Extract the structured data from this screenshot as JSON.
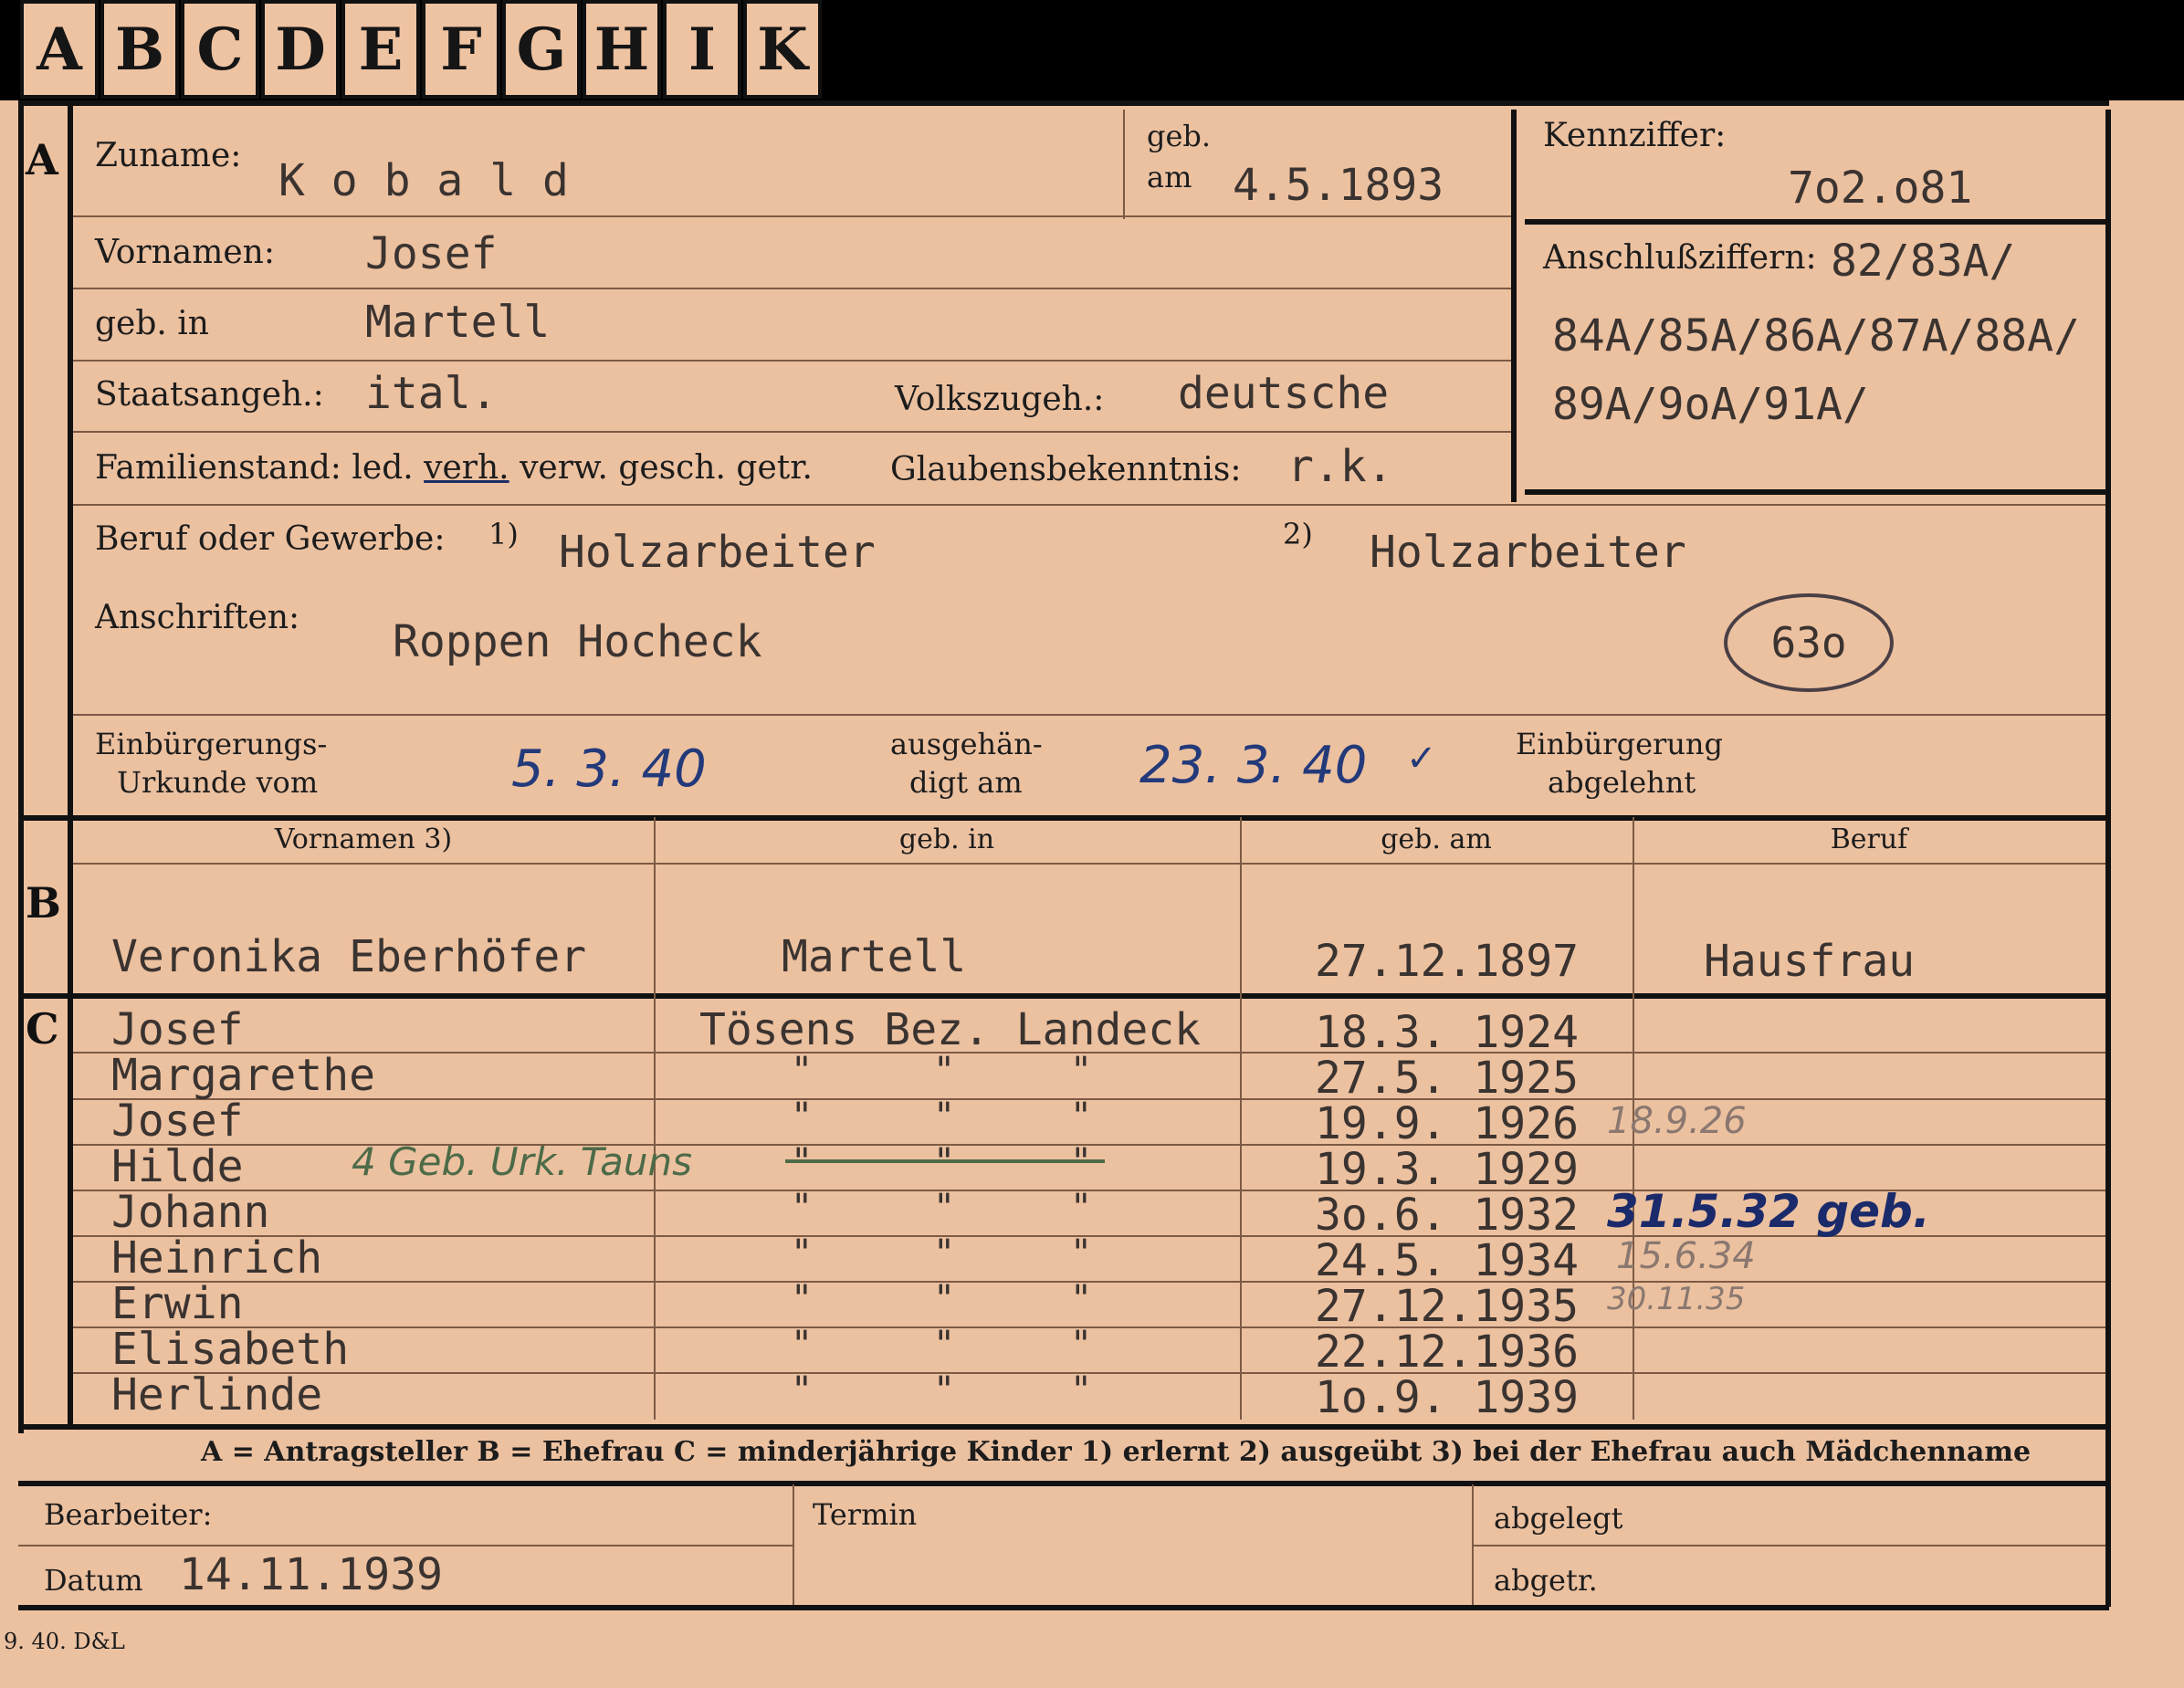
{
  "tabs": [
    "A",
    "B",
    "C",
    "D",
    "E",
    "F",
    "G",
    "H",
    "I",
    "K"
  ],
  "section_letters": {
    "a": "A",
    "b": "B",
    "c": "C"
  },
  "labels": {
    "zuname": "Zuname:",
    "geb": "geb.",
    "am": "am",
    "kennziffer": "Kennziffer:",
    "vornamen": "Vornamen:",
    "anschlussziffern": "Anschlußziffern:",
    "geb_in": "geb. in",
    "staatsangeh": "Staatsangeh.:",
    "volkszugeh": "Volkszugeh.:",
    "familienstand_prefix": "Familienstand: led.",
    "familienstand_verh": "verh.",
    "familienstand_suffix": "verw. gesch. getr.",
    "glaubensbekenntnis": "Glaubensbekenntnis:",
    "beruf": "Beruf oder Gewerbe:",
    "fn1": "1)",
    "fn2": "2)",
    "anschriften": "Anschriften:",
    "einb_urkunde_1": "Einbürgerungs-",
    "einb_urkunde_2": "Urkunde vom",
    "ausgehaendigt_1": "ausgehän-",
    "ausgehaendigt_2": "digt am",
    "einb_abgelehnt_1": "Einbürgerung",
    "einb_abgelehnt_2": "abgelehnt"
  },
  "applicant": {
    "zuname": "K o b a l d",
    "geb_am": "4.5.1893",
    "kennziffer": "7o2.o81",
    "anschluss_lines": [
      "82/83A/",
      "84A/85A/86A/87A/88A/",
      "89A/9oA/91A/"
    ],
    "vornamen": "Josef",
    "geb_in": "Martell",
    "staatsangeh": "ital.",
    "volkszugeh": "deutsche",
    "glaubensbekenntnis": "r.k.",
    "beruf_erlernt": "Holzarbeiter",
    "beruf_ausgeuebt": "Holzarbeiter",
    "anschrift": "Roppen Hocheck",
    "circled_number": "63o",
    "urkunde_vom": "5. 3. 40",
    "ausgehaendigt_am": "23. 3. 40"
  },
  "wife_headers": {
    "vornamen": "Vornamen 3)",
    "geb_in": "geb. in",
    "geb_am": "geb. am",
    "beruf": "Beruf"
  },
  "wife": {
    "name": "Veronika Eberhöfer",
    "geb_in": "Martell",
    "geb_am": "27.12.1897",
    "beruf": "Hausfrau"
  },
  "children_place": "Tösens Bez. Landeck",
  "children": [
    {
      "name": "Josef",
      "date": "18.3. 1924",
      "note": ""
    },
    {
      "name": "Margarethe",
      "date": "27.5. 1925",
      "note": ""
    },
    {
      "name": "Josef",
      "date": "19.9. 1926",
      "note": "18.9.26"
    },
    {
      "name": "Hilde",
      "date": "19.3. 1929",
      "note": ""
    },
    {
      "name": "Johann",
      "date": "3o.6. 1932",
      "note": "31.5.32 geb."
    },
    {
      "name": "Heinrich",
      "date": "24.5. 1934",
      "note": "15.6.34"
    },
    {
      "name": "Erwin",
      "date": "27.12.1935",
      "note": "30.11.35"
    },
    {
      "name": "Elisabeth",
      "date": "22.12.1936",
      "note": ""
    },
    {
      "name": "Herlinde",
      "date": "1o.9. 1939",
      "note": ""
    }
  ],
  "ditto": "\"",
  "hilde_note": "4 Geb. Urk. Tauns",
  "legend": "A = Antragsteller   B = Ehefrau   C = minderjährige Kinder   1) erlernt   2) ausgeübt   3) bei der Ehefrau auch Mädchenname",
  "footer": {
    "bearbeiter": "Bearbeiter:",
    "datum_label": "Datum",
    "datum": "14.11.1939",
    "termin": "Termin",
    "abgelegt": "abgelegt",
    "abgetr": "abgetr.",
    "print_code": "9. 40. D&L"
  }
}
